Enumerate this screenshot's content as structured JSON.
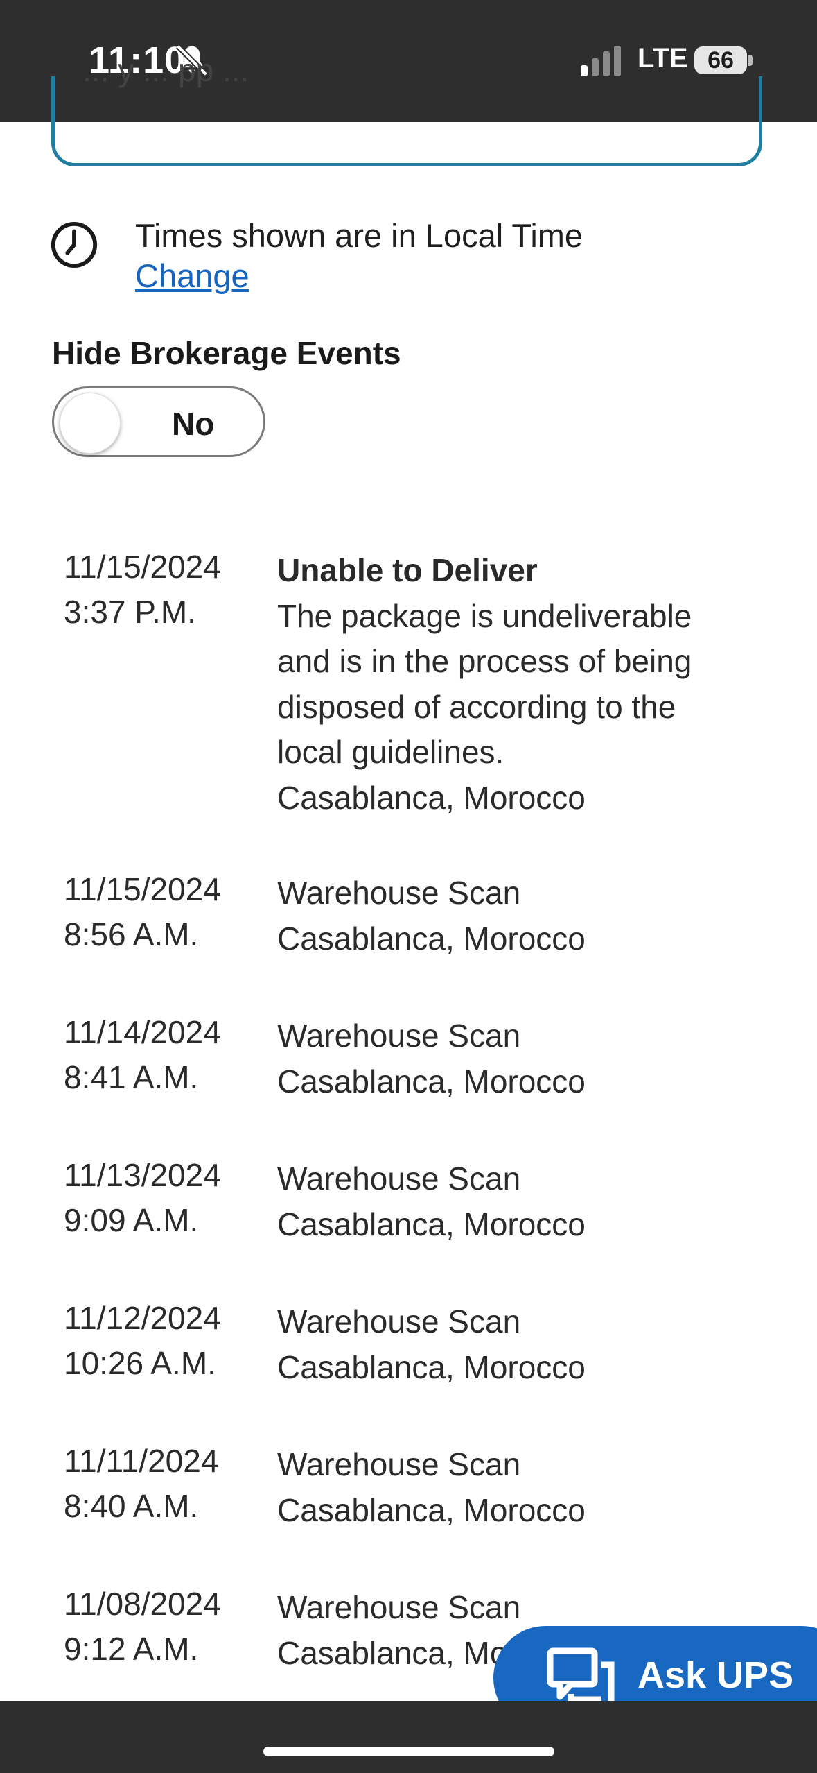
{
  "status_bar": {
    "time": "11:10",
    "network": "LTE",
    "battery": "66"
  },
  "top_card": {
    "partial_text": "... y ... pp ..."
  },
  "time_settings": {
    "note": "Times shown are in Local Time",
    "change_link": "Change"
  },
  "brokerage": {
    "heading": "Hide Brokerage Events",
    "toggle_label": "No"
  },
  "events": [
    {
      "date": "11/15/2024",
      "time": "3:37 P.M.",
      "title": "Unable to Deliver",
      "description": "The package is undeliverable and is in the process of being disposed of according to the local guidelines.",
      "location": "Casablanca, Morocco"
    },
    {
      "date": "11/15/2024",
      "time": "8:56 A.M.",
      "title": "Warehouse Scan",
      "location": "Casablanca, Morocco"
    },
    {
      "date": "11/14/2024",
      "time": "8:41 A.M.",
      "title": "Warehouse Scan",
      "location": "Casablanca, Morocco"
    },
    {
      "date": "11/13/2024",
      "time": "9:09 A.M.",
      "title": "Warehouse Scan",
      "location": "Casablanca, Morocco"
    },
    {
      "date": "11/12/2024",
      "time": "10:26 A.M.",
      "title": "Warehouse Scan",
      "location": "Casablanca, Morocco"
    },
    {
      "date": "11/11/2024",
      "time": "8:40 A.M.",
      "title": "Warehouse Scan",
      "location": "Casablanca, Morocco"
    },
    {
      "date": "11/08/2024",
      "time": "9:12 A.M.",
      "title": "Warehouse Scan",
      "location": "Casablanca, Morocco"
    }
  ],
  "ask_ups": {
    "label": "Ask UPS",
    "icon": "chat-icon"
  },
  "colors": {
    "link": "#1565c0",
    "card_border": "#1f7fa3",
    "ask_button": "#1867c0"
  }
}
